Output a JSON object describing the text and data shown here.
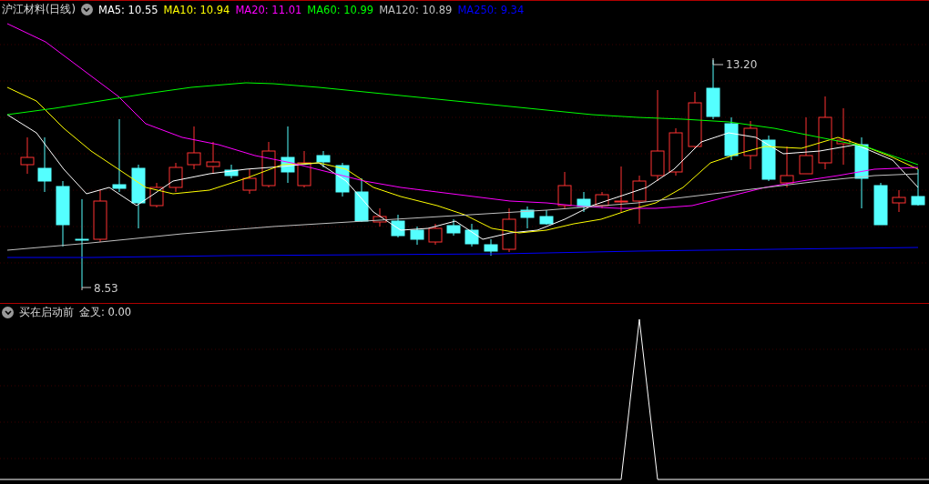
{
  "chart_header": {
    "title": "沪江材料(日线)",
    "ma_legend": [
      {
        "label": "MA5: 10.55",
        "color": "#ffffff"
      },
      {
        "label": "MA10: 10.94",
        "color": "#ffff00"
      },
      {
        "label": "MA20: 11.01",
        "color": "#ff00ff"
      },
      {
        "label": "MA60: 10.99",
        "color": "#00ff00"
      },
      {
        "label": "MA120: 10.89",
        "color": "#c0c0c0"
      },
      {
        "label": "MA250: 9.34",
        "color": "#0000ff"
      }
    ]
  },
  "price_chart": {
    "high_label": "13.20",
    "low_label": "8.53"
  },
  "indicator": {
    "title": "买在启动前",
    "reading": "金叉: 0.00"
  }
}
